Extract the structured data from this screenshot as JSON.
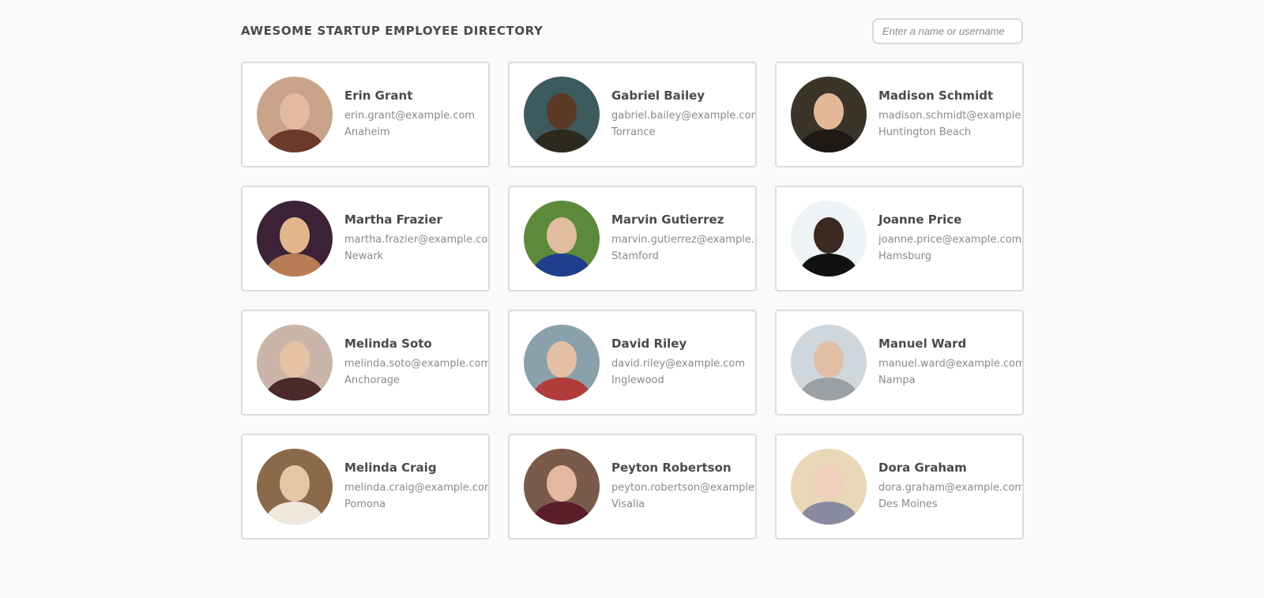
{
  "header": {
    "title": "AWESOME STARTUP EMPLOYEE DIRECTORY",
    "search_placeholder": "Enter a name or username"
  },
  "employees": [
    {
      "name": "Erin Grant",
      "email": "erin.grant@example.com",
      "city": "Anaheim",
      "bg": "#c9a48a",
      "face": "#e3b9a0",
      "shirt": "#6b3a2a"
    },
    {
      "name": "Gabriel Bailey",
      "email": "gabriel.bailey@example.com",
      "city": "Torrance",
      "bg": "#3d5a5e",
      "face": "#5a3a25",
      "shirt": "#2c2a1e"
    },
    {
      "name": "Madison Schmidt",
      "email": "madison.schmidt@example.com",
      "city": "Huntington Beach",
      "bg": "#3a3528",
      "face": "#e2b896",
      "shirt": "#1d1a16"
    },
    {
      "name": "Martha Frazier",
      "email": "martha.frazier@example.com",
      "city": "Newark",
      "bg": "#3b2236",
      "face": "#e2b58c",
      "shirt": "#b87d55"
    },
    {
      "name": "Marvin Gutierrez",
      "email": "marvin.gutierrez@example.com",
      "city": "Stamford",
      "bg": "#5c8a3a",
      "face": "#e0bda0",
      "shirt": "#1f3f8c"
    },
    {
      "name": "Joanne Price",
      "email": "joanne.price@example.com",
      "city": "Hamsburg",
      "bg": "#eef3f5",
      "face": "#3c2a22",
      "shirt": "#111111"
    },
    {
      "name": "Melinda Soto",
      "email": "melinda.soto@example.com",
      "city": "Anchorage",
      "bg": "#c9b6a8",
      "face": "#e6c3a6",
      "shirt": "#4a2a2a"
    },
    {
      "name": "David Riley",
      "email": "david.riley@example.com",
      "city": "Inglewood",
      "bg": "#8aa0aa",
      "face": "#e3c0a4",
      "shirt": "#b23b3b"
    },
    {
      "name": "Manuel Ward",
      "email": "manuel.ward@example.com",
      "city": "Nampa",
      "bg": "#cfd6dc",
      "face": "#e0bfa6",
      "shirt": "#9aa0a4"
    },
    {
      "name": "Melinda Craig",
      "email": "melinda.craig@example.com",
      "city": "Pomona",
      "bg": "#8a6a48",
      "face": "#e6c6a8",
      "shirt": "#efe6dc"
    },
    {
      "name": "Peyton Robertson",
      "email": "peyton.robertson@example.com",
      "city": "Visalia",
      "bg": "#7a5a4a",
      "face": "#e2b9a0",
      "shirt": "#5a1e2a"
    },
    {
      "name": "Dora Graham",
      "email": "dora.graham@example.com",
      "city": "Des Moines",
      "bg": "#e8d8b8",
      "face": "#f0d0bc",
      "shirt": "#8a8aa0"
    }
  ]
}
